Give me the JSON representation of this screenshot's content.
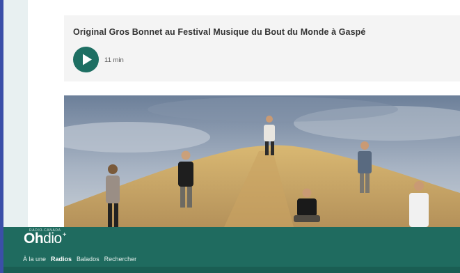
{
  "episode": {
    "title": "Original Gros Bonnet au Festival Musique du Bout du Monde à Gaspé",
    "duration": "11 min",
    "play_icon": "play-icon"
  },
  "photo": {
    "description_icon": "band-photo"
  },
  "app_bar": {
    "brand_small": "RADIO-CANADA",
    "logo_part1": "Oh",
    "logo_part2": "dio",
    "logo_mark": "+",
    "nav": [
      {
        "label": "À la une",
        "active": false
      },
      {
        "label": "Radios",
        "active": true
      },
      {
        "label": "Balados",
        "active": false
      },
      {
        "label": "Rechercher",
        "active": false
      }
    ]
  },
  "colors": {
    "accent": "#1e6f63",
    "app_bar": "#1f6b5f",
    "side_rail": "#e8f0f1"
  }
}
